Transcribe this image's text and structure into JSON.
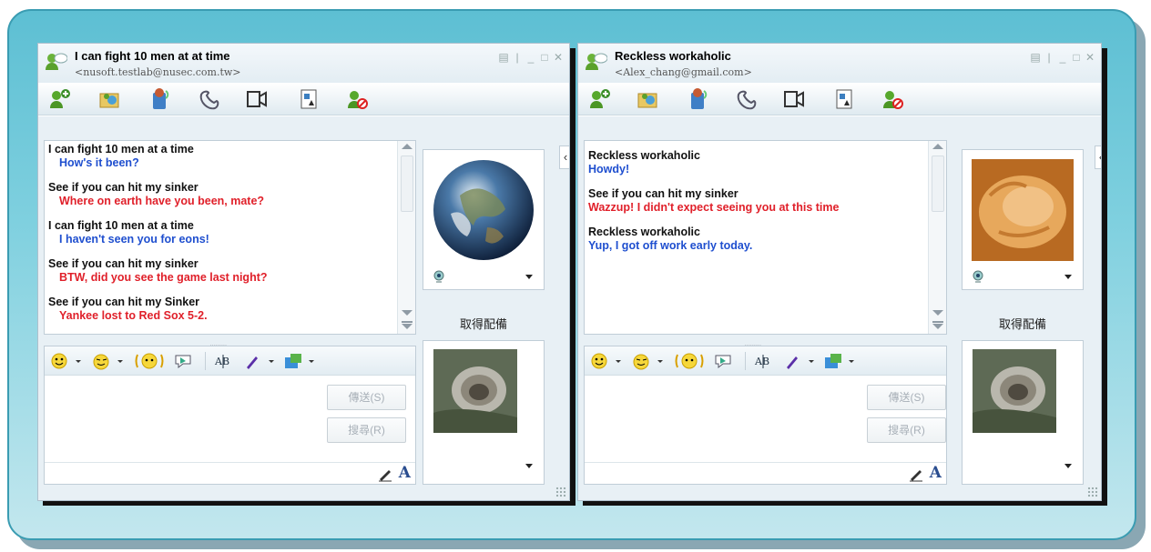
{
  "left_window": {
    "contact_name": "I can fight 10 men at at time",
    "contact_email": "<nusoft.testlab@nusec.com.tw>",
    "messages": [
      {
        "sender": "I can fight 10 men at a time",
        "text": "How's it been?",
        "color": "#1f4fcf"
      },
      {
        "sender": "See if you can hit my sinker",
        "text": "Where on earth have you been, mate?",
        "color": "#e0202a"
      },
      {
        "sender": "I can fight 10 men at a time",
        "text": "I haven't seen you for eons!",
        "color": "#1f4fcf"
      },
      {
        "sender": "See if you can hit my sinker",
        "text": "BTW, did you see the game last night?",
        "color": "#e0202a"
      },
      {
        "sender": "See if you can hit my Sinker",
        "text": "Yankee lost to Red Sox 5-2.",
        "color": "#e0202a"
      }
    ],
    "send_label": "傳送(S)",
    "search_label": "搜尋(R)",
    "side_label": "取得配備",
    "grip": "........."
  },
  "right_window": {
    "contact_name": "Reckless workaholic",
    "contact_email": "<Alex_chang@gmail.com>",
    "messages": [
      {
        "sender": "Reckless workaholic",
        "text": "Howdy!",
        "color": "#1f4fcf"
      },
      {
        "sender": "See if you can hit my sinker",
        "text": "Wazzup! I didn't expect seeing you at this time",
        "color": "#e0202a"
      },
      {
        "sender": "Reckless workaholic",
        "text": "Yup, I got off work early today.",
        "color": "#1f4fcf"
      }
    ],
    "send_label": "傳送(S)",
    "search_label": "搜尋(R)",
    "side_label": "取得配備",
    "grip": "........."
  },
  "toolbar_icons": [
    "add-contact-icon",
    "share-folder-icon",
    "voice-call-icon",
    "phone-icon",
    "video-icon",
    "games-icon",
    "block-icon"
  ],
  "format_icons": [
    "emoticon-icon",
    "wink-icon",
    "nudge-icon",
    "voice-clip-icon",
    "font-icon",
    "paint-icon",
    "background-icon"
  ],
  "font_button": "A"
}
